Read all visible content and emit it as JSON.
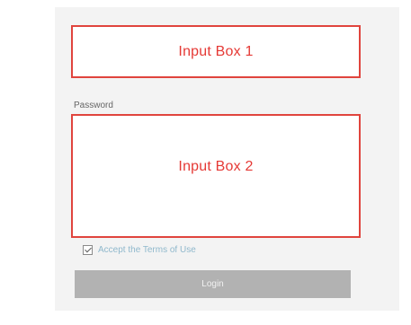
{
  "form": {
    "input_box_1": {
      "placeholder": "Input Box 1"
    },
    "password_label": "Password",
    "input_box_2": {
      "placeholder": "Input Box 2"
    },
    "checkbox": {
      "label": "Accept the Terms of Use",
      "checked": true
    },
    "submit_label": "Login"
  },
  "colors": {
    "accent_border": "#e0443d",
    "placeholder_text": "#e53935",
    "button_background": "#b2b2b2",
    "panel_background": "#f3f3f3",
    "checkbox_label": "#8fb8cc"
  }
}
